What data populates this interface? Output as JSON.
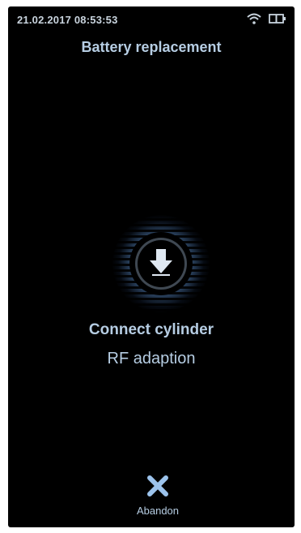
{
  "status_bar": {
    "datetime": "21.02.2017 08:53:53",
    "wifi_icon": "wifi-icon",
    "battery_icon": "battery-icon"
  },
  "screen": {
    "title": "Battery replacement",
    "action_icon": "arrow-down-icon",
    "primary_text": "Connect cylinder",
    "secondary_text": "RF adaption"
  },
  "footer": {
    "abandon_icon": "close-icon",
    "abandon_label": "Abandon"
  },
  "colors": {
    "background": "#000000",
    "text": "#b6cde3",
    "accent_glow": "#96beeb"
  }
}
